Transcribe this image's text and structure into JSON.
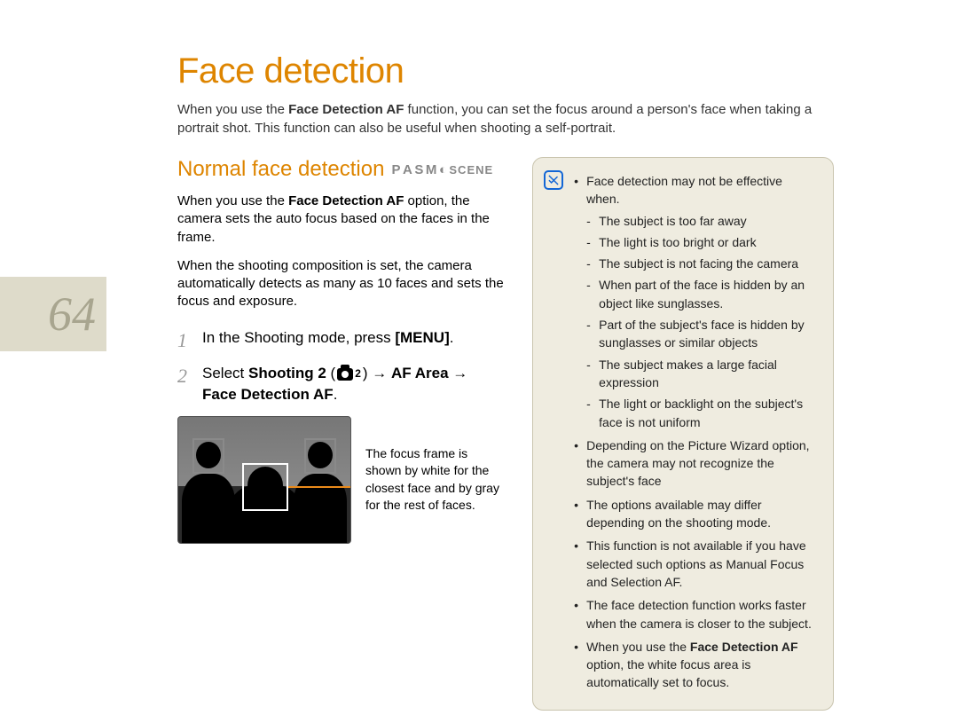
{
  "page_number": "64",
  "title": "Face detection",
  "intro_pre": "When you use the ",
  "intro_bold": "Face Detection AF",
  "intro_post": " function, you can set the focus around a person's face when taking a portrait shot. This function can also be useful when shooting a self-portrait.",
  "section_title": "Normal face detection",
  "modes": {
    "p": "P",
    "a": "A",
    "s": "S",
    "m": "M",
    "night": "◐",
    "scene": "SCENE"
  },
  "para1_pre": "When you use the ",
  "para1_bold": "Face Detection AF",
  "para1_post": " option, the camera sets the auto focus based on the faces in the frame.",
  "para2": "When the shooting composition is set, the camera automatically detects as many as 10 faces and sets the focus and exposure.",
  "step1_num": "1",
  "step1_pre": "In the Shooting mode, press ",
  "step1_bold": "[MENU]",
  "step1_post": ".",
  "step2_num": "2",
  "step2_pre": "Select ",
  "step2_b1": "Shooting 2",
  "step2_paren_open": " (",
  "step2_cam_sub": "2",
  "step2_paren_close": ") ",
  "step2_arrow1": "→ ",
  "step2_b2": "AF Area",
  "step2_arrow2": " → ",
  "step2_b3": "Face Detection AF",
  "step2_post": ".",
  "caption": "The focus frame is shown by white for the closest face and by gray for the rest of faces.",
  "info": {
    "lead": "Face detection may not be effective when.",
    "dashes": [
      "The subject is too far away",
      "The light is too bright or dark",
      "The subject is not facing the camera",
      "When part of the face is hidden by an object like sunglasses.",
      "Part of the subject's face is hidden by sunglasses or similar objects",
      "The subject makes a large facial expression",
      "The light or backlight on the subject's face is not uniform"
    ],
    "bullets": [
      "Depending on the Picture Wizard option, the camera may not recognize the subject's face",
      "The options available may differ depending on the shooting mode.",
      "This function is not available if you have selected such options as Manual Focus and Selection AF.",
      "The face detection function works faster when the camera is closer to the subject."
    ],
    "last_pre": "When you use the ",
    "last_bold": "Face Detection AF",
    "last_post": " option, the white focus area is automatically set to focus."
  }
}
